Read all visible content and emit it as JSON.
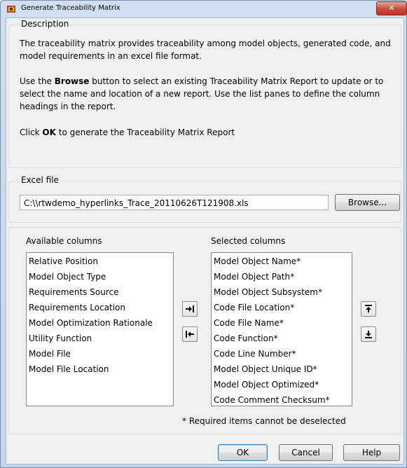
{
  "window": {
    "title": "Generate Traceability Matrix",
    "close_symbol": "✕"
  },
  "description": {
    "legend": "Description",
    "paragraph1": "The traceability matrix provides traceability among model objects, generated code, and model requirements in an excel file format.",
    "paragraph2_before": "Use the ",
    "paragraph2_bold": "Browse",
    "paragraph2_after": " button to select an existing Traceability Matrix Report to update or to select the name and location of a new report. Use the list panes to define the column headings in the report.",
    "paragraph3_before": "Click ",
    "paragraph3_bold": "OK",
    "paragraph3_after": " to generate the Traceability Matrix Report"
  },
  "excel": {
    "legend": "Excel file",
    "file_value": "C:\\\\rtwdemo_hyperlinks_Trace_20110626T121908.xls",
    "browse_label": "Browse..."
  },
  "columns": {
    "available_label": "Available columns",
    "available_items": [
      "Relative Position",
      "Model Object Type",
      "Requirements Source",
      "Requirements Location",
      "Model Optimization Rationale",
      "Utility Function",
      "Model File",
      "Model File Location"
    ],
    "selected_label": "Selected columns",
    "selected_items": [
      "Model Object Name*",
      "Model Object Path*",
      "Model Object Subsystem*",
      "Code File Location*",
      "Code File Name*",
      "Code Function*",
      "Code Line Number*",
      "Model Object Unique ID*",
      "Model Object Optimized*",
      "Code Comment Checksum*"
    ],
    "required_note": "* Required items cannot be deselected"
  },
  "buttons": {
    "ok_label": "OK",
    "cancel_label": "Cancel",
    "help_label": "Help"
  },
  "icons": {
    "app": "matlab-app-icon",
    "add": "move-right-icon",
    "remove": "move-left-icon",
    "up": "move-up-icon",
    "down": "move-down-icon"
  }
}
